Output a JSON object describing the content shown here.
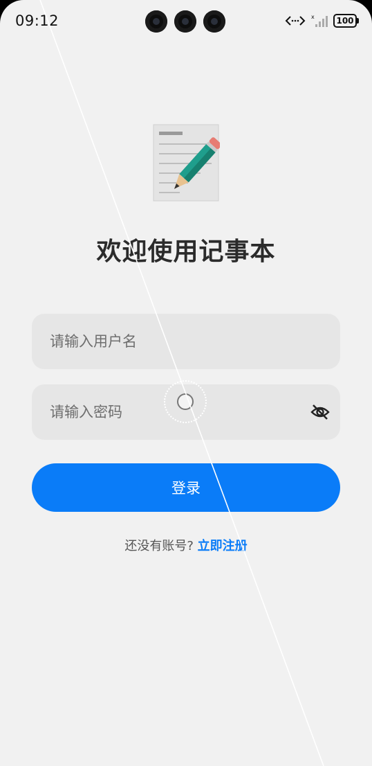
{
  "status_bar": {
    "time": "09:12",
    "battery": "100",
    "icons": [
      "data-transfer-icon",
      "signal-icon",
      "battery-icon"
    ]
  },
  "app": {
    "logo_icon": "notepad-pencil-icon",
    "title": "欢迎使用记事本"
  },
  "form": {
    "username_placeholder": "请输入用户名",
    "password_placeholder": "请输入密码",
    "password_toggle_icon": "eye-off-icon",
    "login_label": "登录"
  },
  "footer": {
    "prompt": "还没有账号?",
    "register_label": "立即注册"
  },
  "colors": {
    "accent": "#0a7cf8",
    "background": "#f1f1f1",
    "field_background": "#e6e6e6"
  }
}
